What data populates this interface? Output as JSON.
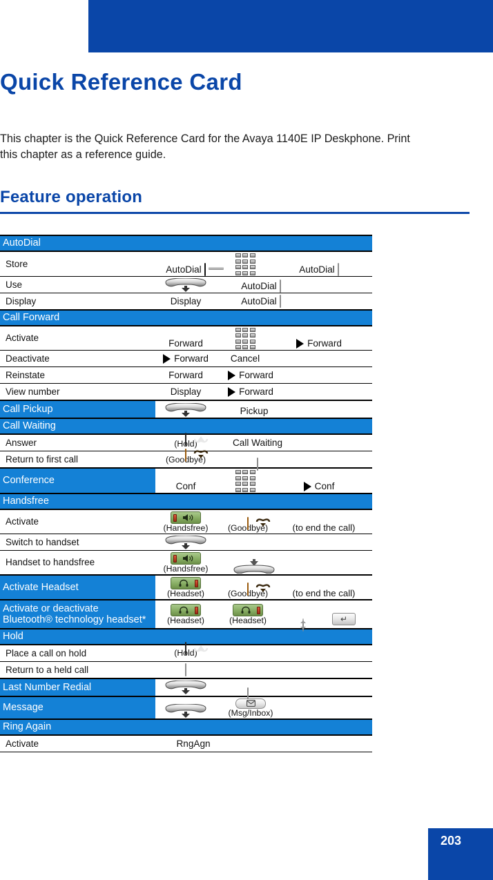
{
  "header": {
    "bar_title": "Quick Reference Card",
    "accent_color": "#0a46a8"
  },
  "page_title": "Quick Reference Card",
  "intro": "This chapter is the Quick Reference Card for the Avaya 1140E IP Deskphone. Print this chapter as a reference guide.",
  "section_heading": "Feature operation",
  "table": {
    "blue_color": "#1481d6",
    "sections": [
      {
        "name": "AutoDial",
        "inline_content": null,
        "rows": [
          {
            "label": "Store",
            "cells": [
              "AutoDial",
              "directory-key",
              "dialpad",
              "AutoDial",
              "line-key"
            ]
          },
          {
            "label": "Use",
            "cells": [
              "handset-lift",
              "AutoDial",
              "line-key"
            ]
          },
          {
            "label": "Display",
            "cells": [
              "Display",
              "AutoDial",
              "line-key"
            ]
          }
        ]
      },
      {
        "name": "Call Forward",
        "inline_content": null,
        "rows": [
          {
            "label": "Activate",
            "cells": [
              "Forward",
              "dialpad",
              "Forward"
            ]
          },
          {
            "label": "Deactivate",
            "cells": [
              "Forward",
              "Cancel"
            ]
          },
          {
            "label": "Reinstate",
            "cells": [
              "Forward",
              "Forward"
            ]
          },
          {
            "label": "View number",
            "cells": [
              "Display",
              "Forward"
            ]
          }
        ]
      },
      {
        "name": "Call Pickup",
        "inline_content": [
          "handset-lift",
          "Pickup"
        ],
        "rows": []
      },
      {
        "name": "Call Waiting",
        "inline_content": null,
        "rows": [
          {
            "label": "Answer",
            "cells": [
              "Hold",
              "Call Waiting"
            ]
          },
          {
            "label": "Return to first call",
            "cells": [
              "Goodbye",
              "line-key"
            ]
          }
        ]
      },
      {
        "name": "Conference",
        "inline_content": [
          "Conf",
          "dialpad",
          "Conf"
        ],
        "rows": []
      },
      {
        "name": "Handsfree",
        "inline_content": null,
        "rows": [
          {
            "label": "Activate",
            "cells": [
              "Handsfree",
              "Goodbye",
              "(to end the call)"
            ]
          },
          {
            "label": "Switch to handset",
            "cells": [
              "handset-lift"
            ]
          },
          {
            "label": "Handset to handsfree",
            "cells": [
              "Handsfree",
              "handset-place"
            ]
          }
        ]
      },
      {
        "name": "Activate Headset",
        "inline_content": [
          "Headset",
          "Goodbye",
          "(to end the call)"
        ],
        "rows": []
      },
      {
        "name": "Activate or deactivate Bluetooth® technology headset*",
        "inline_content": [
          "Headset",
          "Headset",
          "nav-key",
          "enter-key"
        ],
        "rows": []
      },
      {
        "name": "Hold",
        "inline_content": null,
        "rows": [
          {
            "label": "Place a call on hold",
            "cells": [
              "Hold"
            ]
          },
          {
            "label": "Return to a held call",
            "cells": [
              "line-key"
            ]
          }
        ]
      },
      {
        "name": "Last Number Redial",
        "inline_content": [
          "handset-lift",
          "line-key"
        ],
        "rows": []
      },
      {
        "name": "Message",
        "inline_content": [
          "handset-lift",
          "Msg/Inbox"
        ],
        "rows": []
      },
      {
        "name": "Ring Again",
        "inline_content": null,
        "rows": [
          {
            "label": "Activate",
            "cells": [
              "RngAgn"
            ]
          }
        ]
      }
    ],
    "labels": {
      "autodial": "AutoDial",
      "display": "Display",
      "forward": "Forward",
      "cancel": "Cancel",
      "pickup": "Pickup",
      "call_waiting": "Call Waiting",
      "conf": "Conf",
      "rngagn": "RngAgn",
      "hold_cap": "(Hold)",
      "goodbye_cap": "(Goodbye)",
      "handsfree_cap": "(Handsfree)",
      "headset_cap": "(Headset)",
      "msg_cap": "(Msg/Inbox)",
      "end_call_note": "(to end the call)",
      "store": "Store",
      "use": "Use",
      "activate": "Activate",
      "deactivate": "Deactivate",
      "reinstate": "Reinstate",
      "view_number": "View number",
      "answer": "Answer",
      "return_first": "Return to first call",
      "switch_handset": "Switch to handset",
      "handset_to_hf": "Handset to handsfree",
      "place_hold": "Place a call on hold",
      "return_held": "Return to a held call",
      "sect_autodial": "AutoDial",
      "sect_call_forward": "Call Forward",
      "sect_call_pickup": "Call Pickup",
      "sect_call_waiting": "Call Waiting",
      "sect_conference": "Conference",
      "sect_handsfree": "Handsfree",
      "sect_activate_headset": "Activate Headset",
      "sect_bluetooth_l1": "Activate or deactivate",
      "sect_bluetooth_l2": "Bluetooth® technology headset*",
      "sect_hold": "Hold",
      "sect_lnr": "Last Number Redial",
      "sect_message": "Message",
      "sect_ring_again": "Ring Again"
    }
  },
  "footer": {
    "page_number": "203"
  }
}
